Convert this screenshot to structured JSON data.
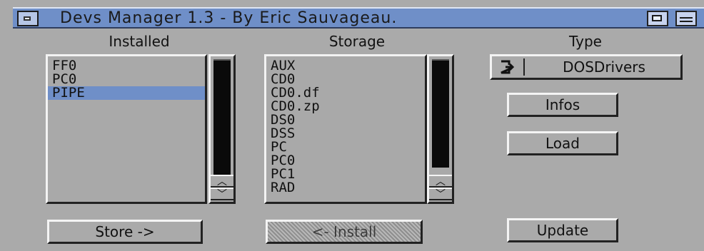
{
  "window": {
    "title": "Devs Manager 1.3 - By Eric Sauvageau."
  },
  "installed": {
    "label": "Installed",
    "items": [
      "FF0",
      "PC0",
      "PIPE"
    ],
    "selected_index": 2
  },
  "storage": {
    "label": "Storage",
    "items": [
      "AUX",
      "CD0",
      "CD0.df",
      "CD0.zp",
      "DS0",
      "DSS",
      "PC",
      "PC0",
      "PC1",
      "RAD"
    ]
  },
  "type": {
    "label": "Type",
    "value": "DOSDrivers"
  },
  "buttons": {
    "infos": "Infos",
    "load": "Load",
    "store": "Store ->",
    "install": "<- Install",
    "update": "Update"
  },
  "icons": {
    "close": "close-icon",
    "depth": "depth-icon",
    "zoom": "zoom-icon",
    "cycle": "cycle-icon",
    "scroll_up": "arrow-up-icon",
    "scroll_down": "arrow-down-icon"
  },
  "colors": {
    "titlebar": "#6f8fc8",
    "selection": "#6f8fc8",
    "window": "#aaaaaa"
  }
}
